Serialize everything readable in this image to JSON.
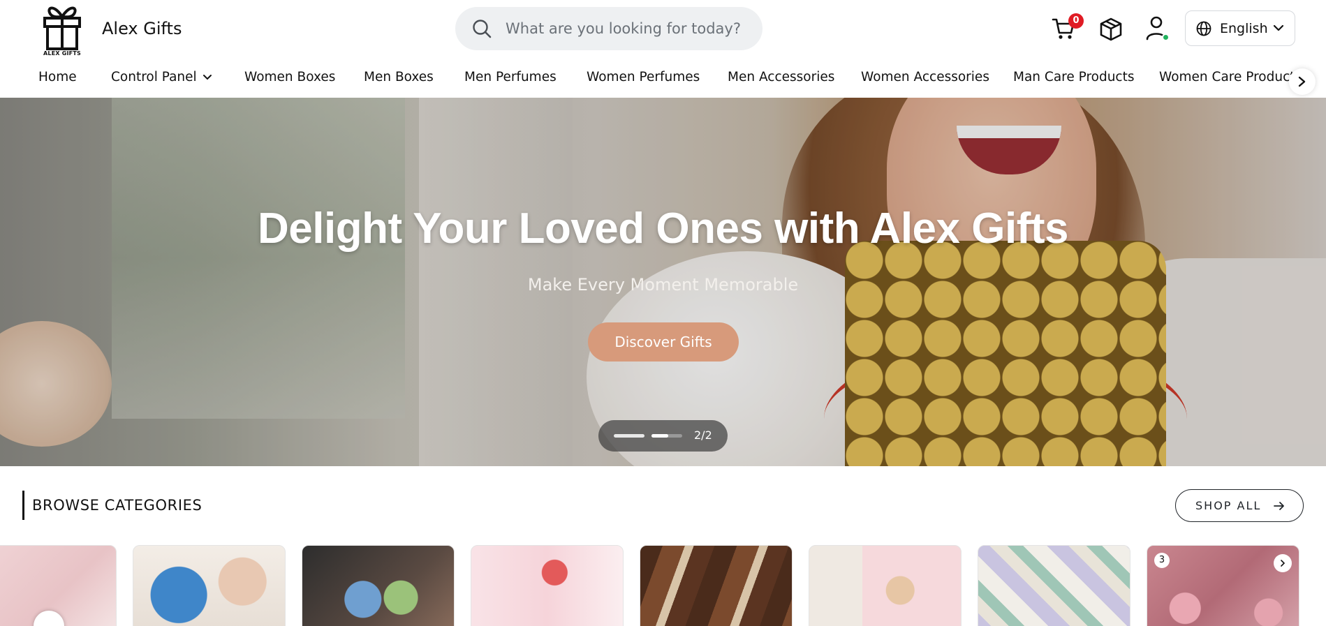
{
  "brand": {
    "logo_caption": "ALEX GIFTS",
    "name": "Alex Gifts"
  },
  "search": {
    "placeholder": "What are you looking for today?",
    "icon": "search-icon"
  },
  "header": {
    "cart_count": "0",
    "language": "English"
  },
  "nav": {
    "items": [
      {
        "label": "Home"
      },
      {
        "label": "Control Panel"
      },
      {
        "label": "Women Boxes"
      },
      {
        "label": "Men Boxes"
      },
      {
        "label": "Men Perfumes"
      },
      {
        "label": "Women Perfumes"
      },
      {
        "label": "Men Accessories"
      },
      {
        "label": "Women Accessories"
      },
      {
        "label": "Man Care Products"
      },
      {
        "label": "Women Care Products"
      }
    ]
  },
  "hero": {
    "title": "Delight Your Loved Ones with Alex Gifts",
    "subtitle": "Make Every Moment Memorable",
    "cta_label": "Discover Gifts",
    "slide_counter": "2/2"
  },
  "categories": {
    "title": "BROWSE CATEGORIES",
    "shop_all_label": "SHOP ALL",
    "card_badge": "3"
  },
  "colors": {
    "accent": "#d79a7b",
    "badge": "#e01b24",
    "online": "#22b35e"
  }
}
